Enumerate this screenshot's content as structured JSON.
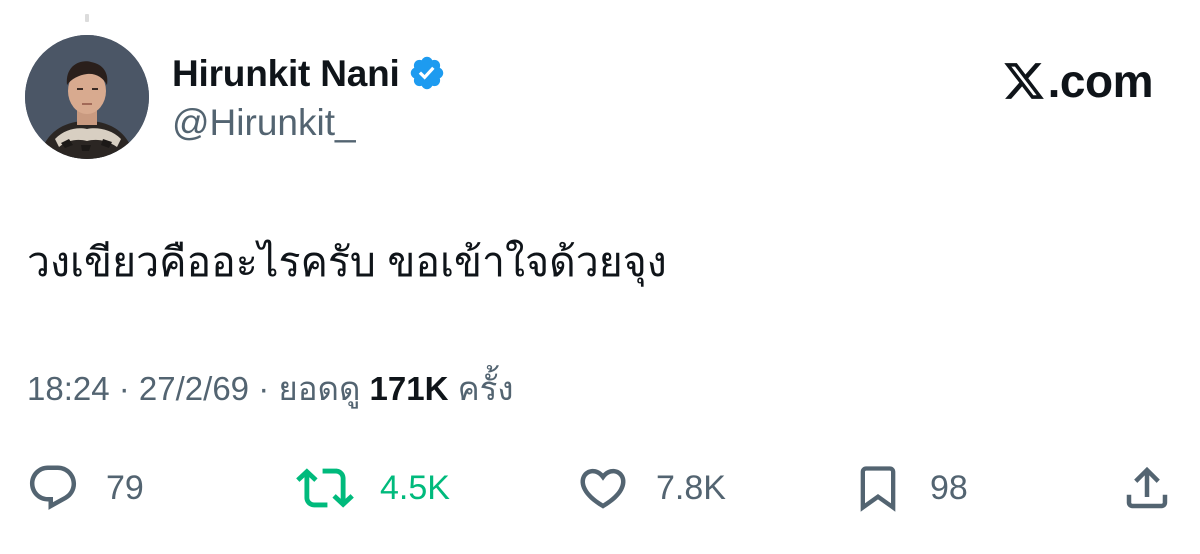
{
  "author": {
    "display_name": "Hirunkit Nani",
    "handle": "@Hirunkit_",
    "avatar_icon": "profile-photo",
    "verified_icon": "verified-badge-icon"
  },
  "brand": {
    "logo_icon": "x-logo-icon",
    "label": ".com"
  },
  "tweet": {
    "text": "วงเขียวคืออะไรครับ ขอเข้าใจด้วยจุง"
  },
  "meta": {
    "time": "18:24",
    "sep1": " · ",
    "date": "27/2/69",
    "sep2": " · ",
    "views_prefix": "ยอดดู ",
    "views_count": "171K",
    "views_suffix": " ครั้ง"
  },
  "actions": {
    "reply_count": "79",
    "retweet_count": "4.5K",
    "like_count": "7.8K",
    "bookmark_count": "98"
  },
  "colors": {
    "text": "#0f1419",
    "secondary": "#536471",
    "retweet_active": "#00ba7c",
    "verified": "#1d9bf0"
  }
}
